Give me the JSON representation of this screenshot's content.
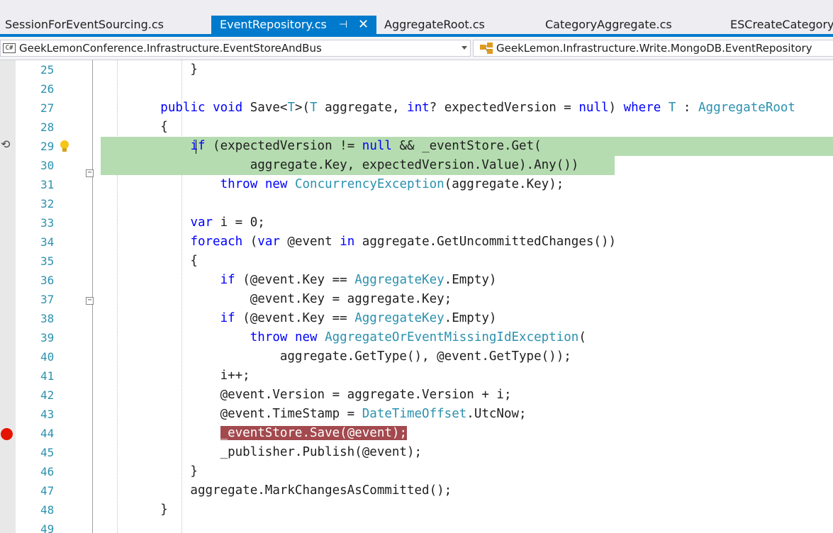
{
  "tabs": [
    {
      "label": "SessionForEventSourcing.cs",
      "active": false
    },
    {
      "label": "EventRepository.cs",
      "active": true
    },
    {
      "label": "AggregateRoot.cs",
      "active": false
    },
    {
      "label": "CategoryAggregate.cs",
      "active": false
    },
    {
      "label": "ESCreateCategory",
      "active": false
    }
  ],
  "tab_pin_glyph": "⊣",
  "tab_close_glyph": "✕",
  "nav": {
    "project_badge": "C#",
    "project": "GeekLemonConference.Infrastructure.EventStoreAndBus",
    "member": "GeekLemon.Infrastructure.Write.MongoDB.EventRepository"
  },
  "accent_color": "#007acc",
  "breakpoint_color": "#e51400",
  "lines": [
    {
      "n": "25",
      "t": [
        [
          "            }",
          ""
        ]
      ]
    },
    {
      "n": "26",
      "t": [
        [
          "",
          ""
        ]
      ]
    },
    {
      "n": "27",
      "t": [
        [
          "        ",
          ""
        ],
        [
          "public",
          "kw"
        ],
        [
          " ",
          ""
        ],
        [
          "void",
          "kw"
        ],
        [
          " Save<",
          ""
        ],
        [
          "T",
          "ty"
        ],
        [
          ">(",
          ""
        ],
        [
          "T",
          "ty"
        ],
        [
          " aggregate, ",
          ""
        ],
        [
          "int",
          "kw"
        ],
        [
          "? expectedVersion = ",
          ""
        ],
        [
          "null",
          "kw"
        ],
        [
          ") ",
          ""
        ],
        [
          "where",
          "kw"
        ],
        [
          " ",
          ""
        ],
        [
          "T",
          "ty"
        ],
        [
          " : ",
          ""
        ],
        [
          "AggregateRoot",
          "ty"
        ]
      ]
    },
    {
      "n": "28",
      "t": [
        [
          "        {",
          ""
        ]
      ]
    },
    {
      "n": "29",
      "t": [
        [
          "            ",
          ""
        ],
        [
          "if",
          "kw"
        ],
        [
          " (expectedVersion != ",
          ""
        ],
        [
          "null",
          "kw"
        ],
        [
          " && _eventStore.Get(",
          ""
        ]
      ]
    },
    {
      "n": "30",
      "t": [
        [
          "                    aggregate.Key, expectedVersion.Value).Any())",
          ""
        ]
      ]
    },
    {
      "n": "31",
      "t": [
        [
          "                ",
          ""
        ],
        [
          "throw",
          "kw"
        ],
        [
          " ",
          ""
        ],
        [
          "new",
          "kw"
        ],
        [
          " ",
          ""
        ],
        [
          "ConcurrencyException",
          "ty"
        ],
        [
          "(aggregate.Key);",
          ""
        ]
      ]
    },
    {
      "n": "32",
      "t": [
        [
          "",
          ""
        ]
      ]
    },
    {
      "n": "33",
      "t": [
        [
          "            ",
          ""
        ],
        [
          "var",
          "kw"
        ],
        [
          " i = 0;",
          ""
        ]
      ]
    },
    {
      "n": "34",
      "t": [
        [
          "            ",
          ""
        ],
        [
          "foreach",
          "kw"
        ],
        [
          " (",
          ""
        ],
        [
          "var",
          "kw"
        ],
        [
          " @event ",
          ""
        ],
        [
          "in",
          "kw"
        ],
        [
          " aggregate.GetUncommittedChanges())",
          ""
        ]
      ]
    },
    {
      "n": "35",
      "t": [
        [
          "            {",
          ""
        ]
      ]
    },
    {
      "n": "36",
      "t": [
        [
          "                ",
          ""
        ],
        [
          "if",
          "kw"
        ],
        [
          " (@event.Key == ",
          ""
        ],
        [
          "AggregateKey",
          "ty"
        ],
        [
          ".Empty)",
          ""
        ]
      ]
    },
    {
      "n": "37",
      "t": [
        [
          "                    @event.Key = aggregate.Key;",
          ""
        ]
      ]
    },
    {
      "n": "38",
      "t": [
        [
          "                ",
          ""
        ],
        [
          "if",
          "kw"
        ],
        [
          " (@event.Key == ",
          ""
        ],
        [
          "AggregateKey",
          "ty"
        ],
        [
          ".Empty)",
          ""
        ]
      ]
    },
    {
      "n": "39",
      "t": [
        [
          "                    ",
          ""
        ],
        [
          "throw",
          "kw"
        ],
        [
          " ",
          ""
        ],
        [
          "new",
          "kw"
        ],
        [
          " ",
          ""
        ],
        [
          "AggregateOrEventMissingIdException",
          "ty"
        ],
        [
          "(",
          ""
        ]
      ]
    },
    {
      "n": "40",
      "t": [
        [
          "                        aggregate.GetType(), @event.GetType());",
          ""
        ]
      ]
    },
    {
      "n": "41",
      "t": [
        [
          "                i++;",
          ""
        ]
      ]
    },
    {
      "n": "42",
      "t": [
        [
          "                @event.Version = aggregate.Version + i;",
          ""
        ]
      ]
    },
    {
      "n": "43",
      "t": [
        [
          "                @event.TimeStamp = ",
          ""
        ],
        [
          "DateTimeOffset",
          "ty"
        ],
        [
          ".UtcNow;",
          ""
        ]
      ]
    },
    {
      "n": "44",
      "t": [
        [
          "                ",
          ""
        ],
        [
          "_eventStore.Save(@event);",
          "bp"
        ]
      ]
    },
    {
      "n": "45",
      "t": [
        [
          "                _publisher.Publish(@event);",
          ""
        ]
      ]
    },
    {
      "n": "46",
      "t": [
        [
          "            }",
          ""
        ]
      ]
    },
    {
      "n": "47",
      "t": [
        [
          "            aggregate.MarkChangesAsCommitted();",
          ""
        ]
      ]
    },
    {
      "n": "48",
      "t": [
        [
          "        }",
          ""
        ]
      ]
    },
    {
      "n": "49",
      "t": [
        [
          "",
          ""
        ]
      ]
    }
  ]
}
